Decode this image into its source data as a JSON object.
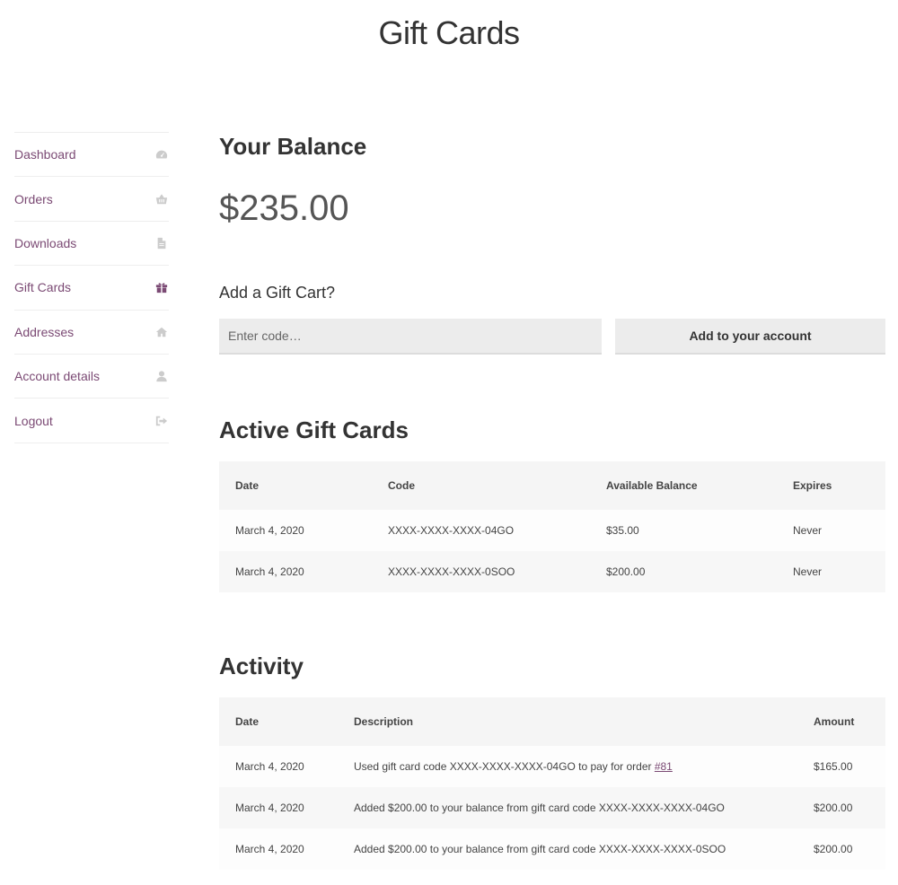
{
  "page": {
    "title": "Gift Cards"
  },
  "sidebar": {
    "items": [
      {
        "label": "Dashboard",
        "icon": "dashboard-icon"
      },
      {
        "label": "Orders",
        "icon": "basket-icon"
      },
      {
        "label": "Downloads",
        "icon": "file-icon"
      },
      {
        "label": "Gift Cards",
        "icon": "gift-icon",
        "active": true
      },
      {
        "label": "Addresses",
        "icon": "home-icon"
      },
      {
        "label": "Account details",
        "icon": "user-icon"
      },
      {
        "label": "Logout",
        "icon": "sign-out-icon"
      }
    ]
  },
  "balance": {
    "heading": "Your Balance",
    "amount": "$235.00"
  },
  "add_card": {
    "label": "Add a Gift Cart?",
    "placeholder": "Enter code…",
    "button": "Add to your account"
  },
  "active_cards": {
    "heading": "Active Gift Cards",
    "columns": [
      "Date",
      "Code",
      "Available Balance",
      "Expires"
    ],
    "rows": [
      [
        "March 4, 2020",
        "XXXX-XXXX-XXXX-04GO",
        "$35.00",
        "Never"
      ],
      [
        "March 4, 2020",
        "XXXX-XXXX-XXXX-0SOO",
        "$200.00",
        "Never"
      ]
    ]
  },
  "activity": {
    "heading": "Activity",
    "columns": [
      "Date",
      "Description",
      "Amount"
    ],
    "rows": [
      {
        "date": "March 4, 2020",
        "description": "Used gift card code XXXX-XXXX-XXXX-04GO to pay for order ",
        "link": "#81",
        "amount": "$165.00"
      },
      {
        "date": "March 4, 2020",
        "description": "Added $200.00 to your balance from gift card code XXXX-XXXX-XXXX-04GO",
        "link": "",
        "amount": "$200.00"
      },
      {
        "date": "March 4, 2020",
        "description": "Added $200.00 to your balance from gift card code XXXX-XXXX-XXXX-0SOO",
        "link": "",
        "amount": "$200.00"
      }
    ]
  },
  "colors": {
    "accent": "#7b4a74",
    "icon": "#cccccc",
    "header_bg": "#f5f5f5"
  }
}
